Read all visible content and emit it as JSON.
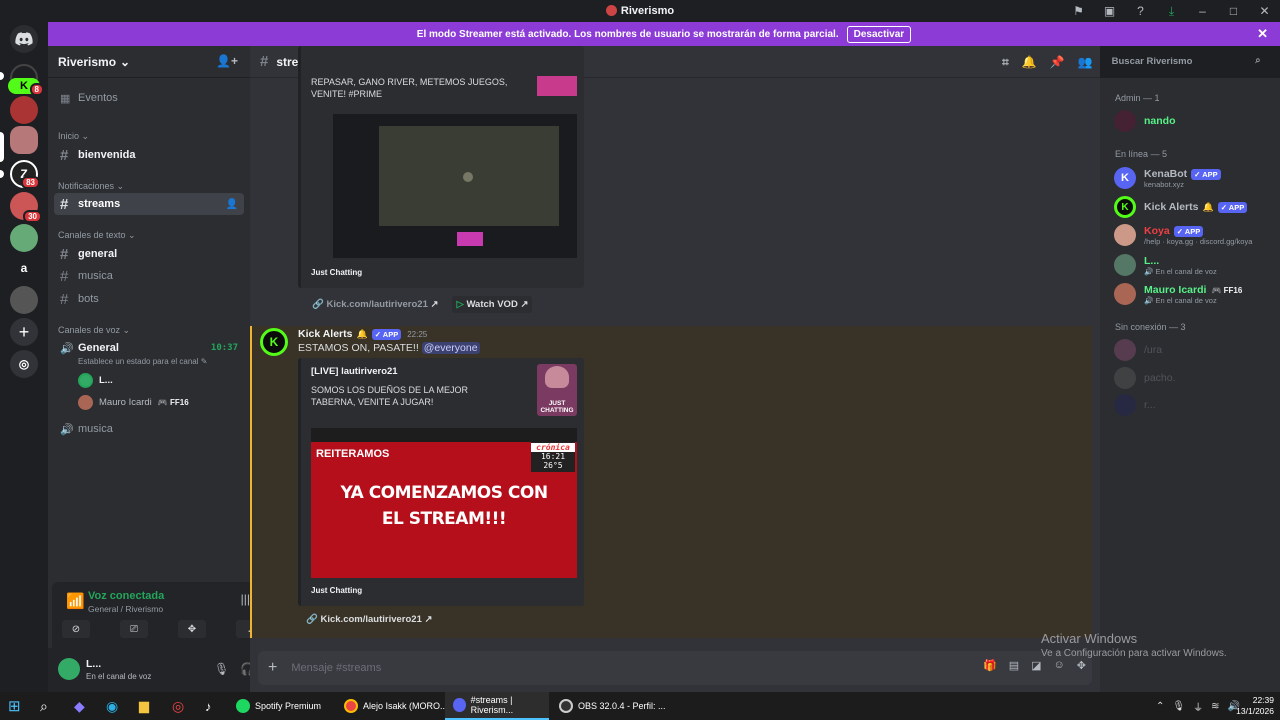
{
  "window": {
    "title": "Riverismo"
  },
  "streamer_bar": {
    "text": "El modo Streamer está activado. Los nombres de usuario se mostrarán de forma parcial.",
    "button": "Desactivar"
  },
  "guild_badges": {
    "kick": "8",
    "g3": "83",
    "g4": "30",
    "letter": "a"
  },
  "server": {
    "name": "Riverismo"
  },
  "channels": {
    "events": "Eventos",
    "cat_inicio": "Inicio",
    "bienvenida": "bienvenida",
    "cat_notif": "Notificaciones",
    "streams": "streams",
    "cat_texto": "Canales de texto",
    "general": "general",
    "musica": "musica",
    "bots": "bots",
    "cat_voz": "Canales de voz",
    "voice_general": "General",
    "voice_time": "10:37",
    "voice_status": "Establece un estado para el canal",
    "voice_user1": "L...",
    "voice_user2": "Mauro Icardi",
    "voice_user2_tag": "FF16",
    "voice_musica": "musica"
  },
  "voice_panel": {
    "status": "Voz conectada",
    "location": "General / Riverismo"
  },
  "user_panel": {
    "name": "L...",
    "status": "En el canal de voz"
  },
  "chat": {
    "channel": "streams",
    "embed1_desc": "REPASAR, GANO RIVER, METEMOS JUEGOS, VENITE! #PRIME",
    "embed1_footer": "Just Chatting",
    "link1": "Kick.com/lautirivero21",
    "watch_vod": "Watch VOD",
    "msg_author": "Kick Alerts",
    "msg_app": "APP",
    "msg_time": "22:25",
    "msg_text": "ESTAMOS ON, PASATE!!",
    "msg_mention": "@everyone",
    "embed2_title": "[LIVE] lautirivero21",
    "embed2_desc": "SOMOS LOS DUEÑOS DE LA MEJOR TABERNA, VENITE A JUGAR!",
    "thumb_text": "JUST CHATTING",
    "image_top": "REITERAMOS",
    "image_main": "YA COMENZAMOS CON EL STREAM!!!",
    "image_logo": "crónica",
    "image_clock": "16:21",
    "image_clock2": "26°5",
    "embed2_footer": "Just Chatting",
    "link2": "Kick.com/lautirivero21",
    "composer_placeholder": "Mensaje #streams"
  },
  "search": {
    "placeholder": "Buscar Riverismo"
  },
  "members": {
    "cat_admin": "Admin — 1",
    "admin1": "nando",
    "cat_online": "En línea — 5",
    "m1": "KenaBot",
    "m1_sub": "kenabot.xyz",
    "m2": "Kick Alerts",
    "m3": "Koya",
    "m3_sub": "/help · koya.gg · discord.gg/koya",
    "m4": "L...",
    "m4_sub": "En el canal de voz",
    "m5": "Mauro Icardi",
    "m5_tag": "FF16",
    "m5_sub": "En el canal de voz",
    "app": "APP",
    "cat_offline": "Sin conexión — 3",
    "off1": "/ura",
    "off2": "pacho.",
    "off3": "r..."
  },
  "watermark": {
    "title": "Activar Windows",
    "sub": "Ve a Configuración para activar Windows."
  },
  "taskbar": {
    "spotify": "Spotify Premium",
    "chrome": "Alejo Isakk (MORO...",
    "discord": "#streams | Riverism...",
    "obs": "OBS 32.0.4 - Perfil: ...",
    "time": "22:39",
    "date": "13/1/2026"
  },
  "colors": {
    "accent": "#5865f2",
    "streamer": "#8c3bd6",
    "kick": "#53fc18",
    "mention_bg": "#3c4270"
  }
}
